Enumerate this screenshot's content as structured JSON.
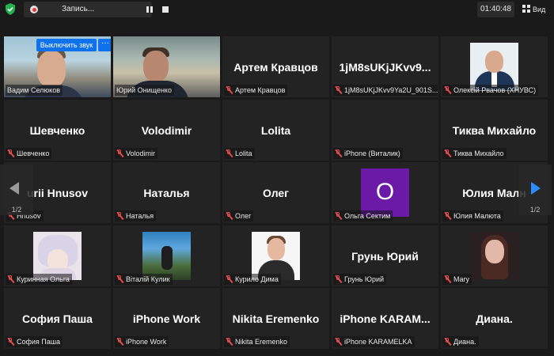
{
  "topbar": {
    "recording_label": "Запись...",
    "timer": "01:40:48",
    "view_label": "Вид"
  },
  "hover_controls": {
    "mute_button": "Выключить звук",
    "more_button": "···"
  },
  "pager": {
    "left_page": "1/2",
    "right_page": "1/2"
  },
  "tiles": [
    {
      "big": "",
      "label": "Вадим Селюков"
    },
    {
      "big": "",
      "label": "Юрий Онищенко"
    },
    {
      "big": "Артем Кравцов",
      "label": "Артем Кравцов"
    },
    {
      "big": "1jM8sUKjJKvv9...",
      "label": "1jM8sUKjJKvv9Ya2U_901S..."
    },
    {
      "big": "",
      "label": "Олексій Рвачов (ХНУВС)"
    },
    {
      "big": "Шевченко",
      "label": "Шевченко"
    },
    {
      "big": "Volodimir",
      "label": "Volodimir"
    },
    {
      "big": "Lolita",
      "label": "Lolita"
    },
    {
      "big": "",
      "label": "iPhone (Виталик)"
    },
    {
      "big": "Тиква Михайло",
      "label": "Тиква Михайло"
    },
    {
      "big": "urii Hnusov",
      "label": "Hnusov"
    },
    {
      "big": "Наталья",
      "label": "Наталья"
    },
    {
      "big": "Олег",
      "label": "Олег"
    },
    {
      "big": "",
      "label": "Ольга Сектим",
      "letter": "О"
    },
    {
      "big": "Юлия Малн",
      "label": "Юлия Малюта"
    },
    {
      "big": "",
      "label": "Куринная Ольга"
    },
    {
      "big": "",
      "label": "Віталій Кулик"
    },
    {
      "big": "",
      "label": "Курило Дима"
    },
    {
      "big": "Грунь Юрий",
      "label": "Грунь Юрий"
    },
    {
      "big": "",
      "label": "Mary"
    },
    {
      "big": "София Паша",
      "label": "София Паша"
    },
    {
      "big": "iPhone Work",
      "label": "iPhone Work"
    },
    {
      "big": "Nikita Eremenko",
      "label": "Nikita Eremenko"
    },
    {
      "big": "iPhone  KARAM...",
      "label": "iPhone KARAMELKA"
    },
    {
      "big": "Диана.",
      "label": "Диана."
    }
  ]
}
